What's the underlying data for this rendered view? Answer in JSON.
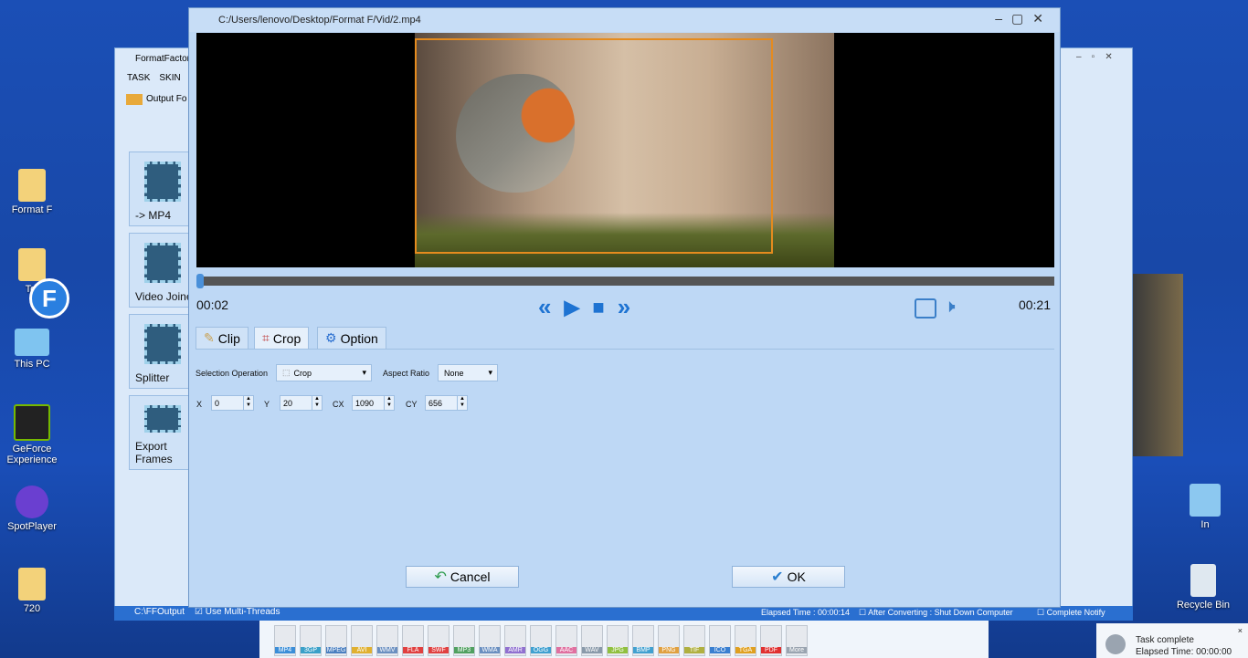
{
  "desktop": {
    "left_icons": [
      "Format F",
      "Tot",
      "This PC",
      "GeForce Experience",
      "SpotPlayer",
      "720"
    ],
    "right_icons": [
      "In",
      "Recycle Bin"
    ]
  },
  "bg_window": {
    "title": "FormatFactor",
    "menu": [
      "TASK",
      "SKIN"
    ],
    "output_folder": "Output Fo",
    "side_buttons": [
      "-> MP4",
      "Video Joiner",
      "Splitter",
      "Export Frames"
    ],
    "status_path": "C:\\FFOutput",
    "multi_threads": "Use Multi-Threads",
    "elapsed": "Elapsed Time : 00:00:14",
    "after_converting": "After Converting : Shut Down Computer",
    "complete_notify": "Complete Notify"
  },
  "dialog": {
    "title": "C:/Users/lenovo/Desktop/Format F/Vid/2.mp4",
    "time_current": "00:02",
    "time_total": "00:21",
    "progress_fraction": 0.0,
    "tabs": [
      {
        "label": "Clip",
        "icon": "clip-icon"
      },
      {
        "label": "Crop",
        "icon": "crop-icon",
        "active": true
      },
      {
        "label": "Option",
        "icon": "gear-icon"
      }
    ],
    "selection_operation_label": "Selection Operation",
    "selection_operation_value": "Crop",
    "aspect_ratio_label": "Aspect Ratio",
    "aspect_ratio_value": "None",
    "fields": [
      {
        "label": "X",
        "value": "0"
      },
      {
        "label": "Y",
        "value": "20"
      },
      {
        "label": "CX",
        "value": "1090"
      },
      {
        "label": "CY",
        "value": "656"
      }
    ],
    "cancel": "Cancel",
    "ok": "OK",
    "accent": "#1e73d2",
    "crop_color": "#e58b1e"
  },
  "toolbar": [
    "MP4",
    "3GP",
    "MPEG",
    "AVI",
    "WMV",
    "FLA",
    "SWF",
    "MP3",
    "WMA",
    "AMR",
    "OGG",
    "AAC",
    "WAV",
    "JPG",
    "BMP",
    "PNG",
    "TIF",
    "ICO",
    "TGA",
    "PDF",
    "More"
  ],
  "toolbar_colors": [
    "#3b8ed8",
    "#3aa0c8",
    "#4a7fc0",
    "#e0b030",
    "#6a8fc0",
    "#e04040",
    "#e04040",
    "#50a060",
    "#6a8fc0",
    "#9070d0",
    "#40a0d0",
    "#e070a0",
    "#8a9aaa",
    "#90c040",
    "#40a0d0",
    "#e0a040",
    "#b0b040",
    "#3a7fd0",
    "#e0a020",
    "#e03030",
    "#9aa4b0"
  ],
  "notification": {
    "title": "Task complete",
    "text": "Elapsed Time: 00:00:00"
  }
}
